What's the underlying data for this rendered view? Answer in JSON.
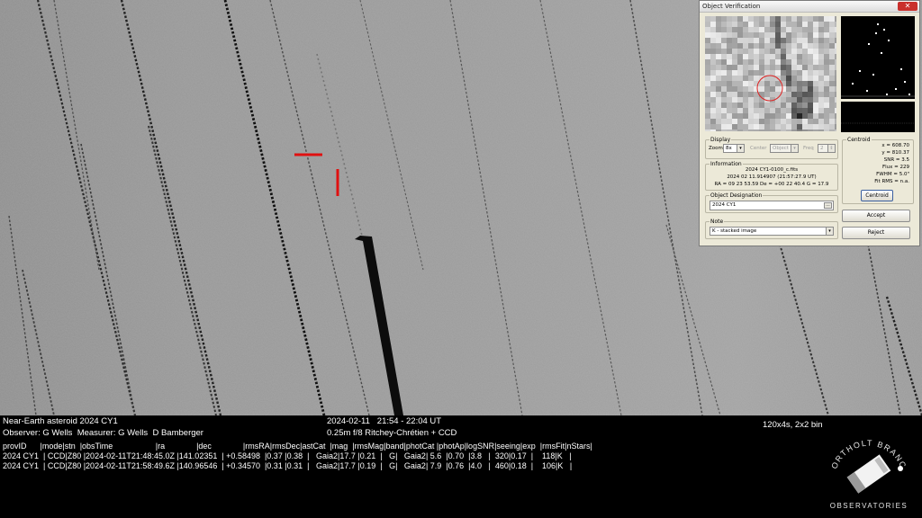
{
  "caption": {
    "object": "Near-Earth asteroid 2024 CY1",
    "observers": "Observer: G Wells  Measurer: G Wells  D Bamberger",
    "date_time": "2024-02-11   21:54 - 22:04 UT",
    "telescope": "0.25m f/8 Ritchey-Chrétien + CCD",
    "exposure": "120x4s, 2x2 bin",
    "table_header": "provID      |mode|stn  |obsTime                   |ra              |dec              |rmsRA|rmsDec|astCat  |mag  |rmsMag|band|photCat |photAp|logSNR|seeing|exp  |rmsFit|nStars|",
    "rows": [
      "2024 CY1  | CCD|Z80 |2024-02-11T21:48:45.0Z |141.02351  | +0.58498  |0.37 |0.38  |   Gaia2|17.7 |0.21  |   G|   Gaia2| 5.6  |0.70  |3.8   |  320|0.17  |    118|K   |",
      "2024 CY1  | CCD|Z80 |2024-02-11T21:58:49.6Z |140.96546  | +0.34570  |0.31 |0.31  |   Gaia2|17.7 |0.19  |   G|   Gaia2| 7.9  |0.76  |4.0   |  460|0.18  |    106|K   |"
    ]
  },
  "logo": {
    "line1": "NORTHOLT BRANCH",
    "line2": "OBSERVATORIES"
  },
  "window": {
    "title": "Object Verification",
    "close_label": "✕",
    "display": {
      "group_label": "Display",
      "zoom_label": "Zoom",
      "zoom_value": "8x",
      "center_label": "Center",
      "center_value": "Object",
      "freq_label": "Freq",
      "freq_value": "2"
    },
    "information": {
      "group_label": "Information",
      "file": "2024 CY1-0100_c.fits",
      "time": "2024 02 11.914907 (21:57:27.9 UT)",
      "coords": "RA = 09 23 53.59   De = +00 22 40.4   G = 17.9"
    },
    "designation": {
      "group_label": "Object Designation",
      "value": "2024 CY1",
      "btn": "..."
    },
    "note": {
      "group_label": "Note",
      "value": "K - stacked image"
    },
    "centroid": {
      "group_label": "Centroid",
      "x": "x = 608.70",
      "y": "y = 810.37",
      "snr": "SNR = 3.5",
      "flux": "Flux = 229",
      "fwhm": "FWHM = 5.0\"",
      "fit": "Fit RMS = n.a.",
      "button": "Centroid"
    },
    "accept_label": "Accept",
    "reject_label": "Reject"
  },
  "colors": {
    "marker": "#e01010",
    "window_bg": "#ece9d8",
    "caption_text": "#ffffff"
  }
}
